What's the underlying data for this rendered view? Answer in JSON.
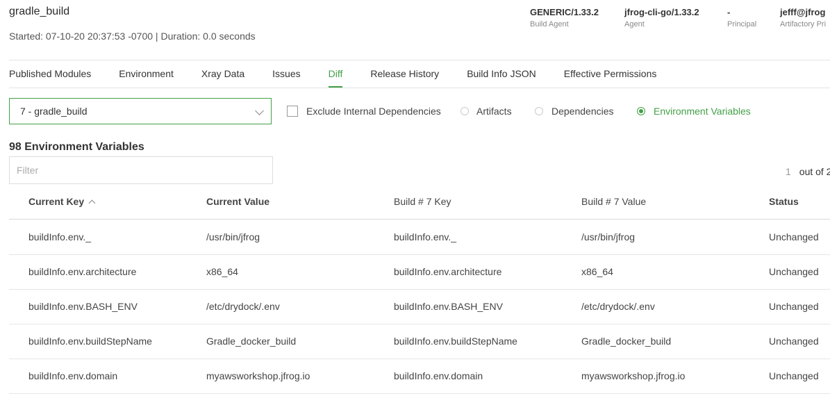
{
  "build": {
    "name": "gradle_build",
    "subtitle": "Started: 07-10-20 20:37:53 -0700 | Duration: 0.0 seconds"
  },
  "meta": [
    {
      "value": "GENERIC/1.33.2",
      "label": "Build Agent"
    },
    {
      "value": "jfrog-cli-go/1.33.2",
      "label": "Agent"
    },
    {
      "value": "-",
      "label": "Principal"
    },
    {
      "value": "jefff@jfrog",
      "label": "Artifactory Pri"
    }
  ],
  "tabs": [
    {
      "label": "Published Modules"
    },
    {
      "label": "Environment"
    },
    {
      "label": "Xray Data"
    },
    {
      "label": "Issues"
    },
    {
      "label": "Diff"
    },
    {
      "label": "Release History"
    },
    {
      "label": "Build Info JSON"
    },
    {
      "label": "Effective Permissions"
    }
  ],
  "active_tab": "Diff",
  "diff": {
    "selected_build": "7 - gradle_build",
    "exclude_label": "Exclude Internal Dependencies",
    "options": [
      "Artifacts",
      "Dependencies",
      "Environment Variables"
    ],
    "selected_option": "Environment Variables"
  },
  "table": {
    "count_title": "98 Environment Variables",
    "filter_placeholder": "Filter",
    "pager_page": "1",
    "pager_text": "out of 2",
    "columns": [
      "Current Key",
      "Current Value",
      "Build # 7 Key",
      "Build # 7 Value",
      "Status"
    ],
    "rows": [
      [
        "buildInfo.env._",
        "/usr/bin/jfrog",
        "buildInfo.env._",
        "/usr/bin/jfrog",
        "Unchanged"
      ],
      [
        "buildInfo.env.architecture",
        "x86_64",
        "buildInfo.env.architecture",
        "x86_64",
        "Unchanged"
      ],
      [
        "buildInfo.env.BASH_ENV",
        "/etc/drydock/.env",
        "buildInfo.env.BASH_ENV",
        "/etc/drydock/.env",
        "Unchanged"
      ],
      [
        "buildInfo.env.buildStepName",
        "Gradle_docker_build",
        "buildInfo.env.buildStepName",
        "Gradle_docker_build",
        "Unchanged"
      ],
      [
        "buildInfo.env.domain",
        "myawsworkshop.jfrog.io",
        "buildInfo.env.domain",
        "myawsworkshop.jfrog.io",
        "Unchanged"
      ]
    ]
  },
  "colors": {
    "accent": "#43a047"
  }
}
